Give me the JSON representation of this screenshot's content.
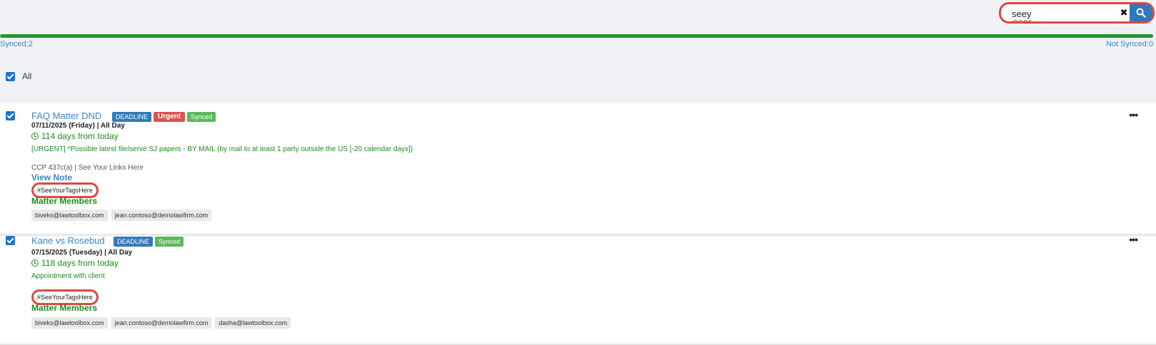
{
  "search": {
    "value": "seey",
    "clear_symbol": "✖"
  },
  "sync": {
    "synced_label": "Synced:2",
    "not_synced_label": "Not Synced:0",
    "progress_percent": 100
  },
  "select_all": {
    "label": "All",
    "checked": true
  },
  "items": [
    {
      "title": "FAQ Matter DND",
      "badges": [
        "DEADLINE",
        "Urgent",
        "Synced"
      ],
      "date": "07/11/2025 (Friday)  |   All Day",
      "days": "114 days from today",
      "description": "[URGENT] *Possible latest file/serve SJ papers - BY MAIL (by mail to at least 1 party outside the US [-20 calendar days])",
      "code": "CCP 437c(a)   |   See Your Links Here",
      "view_note": "View Note",
      "tag": "#SeeYourTagsHere",
      "members_heading": "Matter Members",
      "members": [
        "biveks@lawtoolbox.com",
        "jean.contoso@demolawfirm.com"
      ],
      "more": "•••"
    },
    {
      "title": "Kane vs Rosebud",
      "badges": [
        "DEADLINE",
        "Synced"
      ],
      "date": "07/15/2025 (Tuesday)  |   All Day",
      "days": "118 days from today",
      "description": "Appointment with client",
      "tag": "#SeeYourTagsHere",
      "members_heading": "Matter Members",
      "members": [
        "biveks@lawtoolbox.com",
        "jean.contoso@demolawfirm.com",
        "dasha@lawtoolbox.com"
      ],
      "more": "•••"
    }
  ],
  "colors": {
    "accent": "#3a86c9",
    "progress": "#1f9a2c",
    "highlight": "#e0483e",
    "green_text": "#1e8b1e"
  },
  "icons": {
    "search": "search-icon",
    "clear": "close-icon",
    "clock": "clock-icon",
    "more": "more-icon"
  }
}
